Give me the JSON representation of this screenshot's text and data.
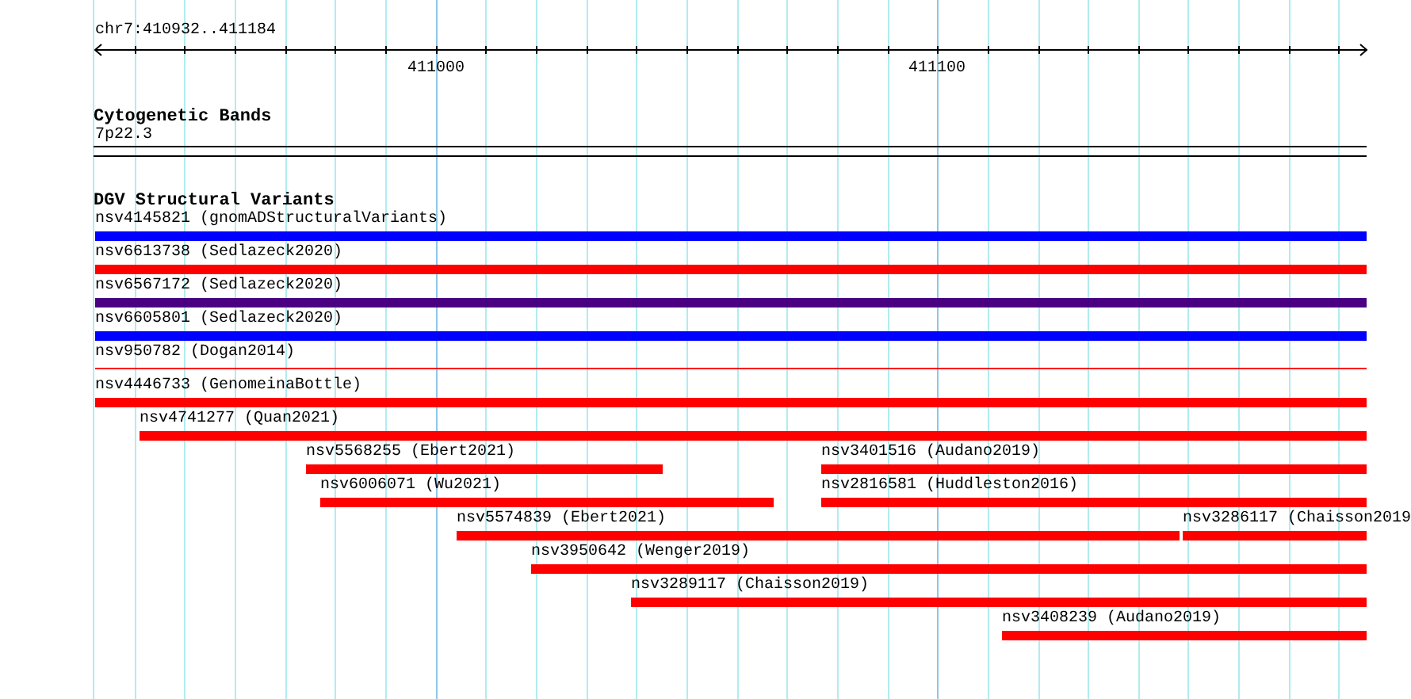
{
  "ruler": {
    "location": "chr7:410932..411184",
    "tick_labels": [
      "411000",
      "411100"
    ]
  },
  "cytoband": {
    "title": "Cytogenetic Bands",
    "band": "7p22.3"
  },
  "dgv": {
    "title": "DGV Structural Variants",
    "rows": [
      {
        "features": [
          {
            "label": "nsv4145821 (gnomADStructuralVariants)",
            "kind": "bar",
            "color": "#0000ff"
          }
        ]
      },
      {
        "features": [
          {
            "label": "nsv6613738 (Sedlazeck2020)",
            "kind": "bar",
            "color": "#ff0000"
          }
        ]
      },
      {
        "features": [
          {
            "label": "nsv6567172 (Sedlazeck2020)",
            "kind": "bar",
            "color": "#4b0082"
          }
        ]
      },
      {
        "features": [
          {
            "label": "nsv6605801 (Sedlazeck2020)",
            "kind": "bar",
            "color": "#0000ff"
          }
        ]
      },
      {
        "features": [
          {
            "label": "nsv950782 (Dogan2014)",
            "kind": "line",
            "color": "#ff0000"
          }
        ]
      },
      {
        "features": [
          {
            "label": "nsv4446733 (GenomeinaBottle)",
            "kind": "bar",
            "color": "#ff0000"
          }
        ]
      },
      {
        "features": [
          {
            "label": "nsv4741277 (Quan2021)",
            "kind": "bar",
            "color": "#ff0000"
          }
        ]
      },
      {
        "features": [
          {
            "label": "nsv5568255 (Ebert2021)",
            "kind": "bar",
            "color": "#ff0000"
          },
          {
            "label": "nsv3401516 (Audano2019)",
            "kind": "bar",
            "color": "#ff0000"
          }
        ]
      },
      {
        "features": [
          {
            "label": "nsv6006071 (Wu2021)",
            "kind": "bar",
            "color": "#ff0000"
          },
          {
            "label": "nsv2816581 (Huddleston2016)",
            "kind": "bar",
            "color": "#ff0000"
          }
        ]
      },
      {
        "features": [
          {
            "label": "nsv5574839 (Ebert2021)",
            "kind": "bar",
            "color": "#ff0000"
          },
          {
            "label": "nsv3286117 (Chaisson2019",
            "kind": "bar",
            "color": "#ff0000"
          }
        ]
      },
      {
        "features": [
          {
            "label": "nsv3950642 (Wenger2019)",
            "kind": "bar",
            "color": "#ff0000"
          }
        ]
      },
      {
        "features": [
          {
            "label": "nsv3289117 (Chaisson2019)",
            "kind": "bar",
            "color": "#ff0000"
          }
        ]
      },
      {
        "features": [
          {
            "label": "nsv3408239 (Audano2019)",
            "kind": "bar",
            "color": "#ff0000"
          }
        ]
      }
    ]
  }
}
